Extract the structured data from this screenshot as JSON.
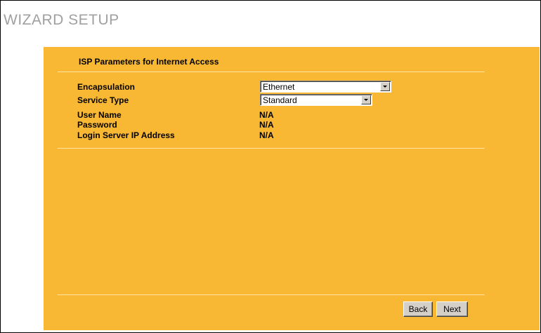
{
  "page": {
    "title": "WIZARD SETUP"
  },
  "section": {
    "title": "ISP Parameters for Internet Access"
  },
  "fields": {
    "encapsulation": {
      "label": "Encapsulation",
      "value": "Ethernet"
    },
    "service_type": {
      "label": "Service Type",
      "value": "Standard"
    },
    "user_name": {
      "label": "User Name",
      "value": "N/A"
    },
    "password": {
      "label": "Password",
      "value": "N/A"
    },
    "login_server_ip": {
      "label": "Login Server IP Address",
      "value": "N/A"
    }
  },
  "buttons": {
    "back": "Back",
    "next": "Next"
  },
  "colors": {
    "panel": "#f9b833",
    "title": "#a0a0a0",
    "button_face": "#d4d0c8"
  },
  "icons": {
    "dropdown": "chevron-down-icon"
  }
}
